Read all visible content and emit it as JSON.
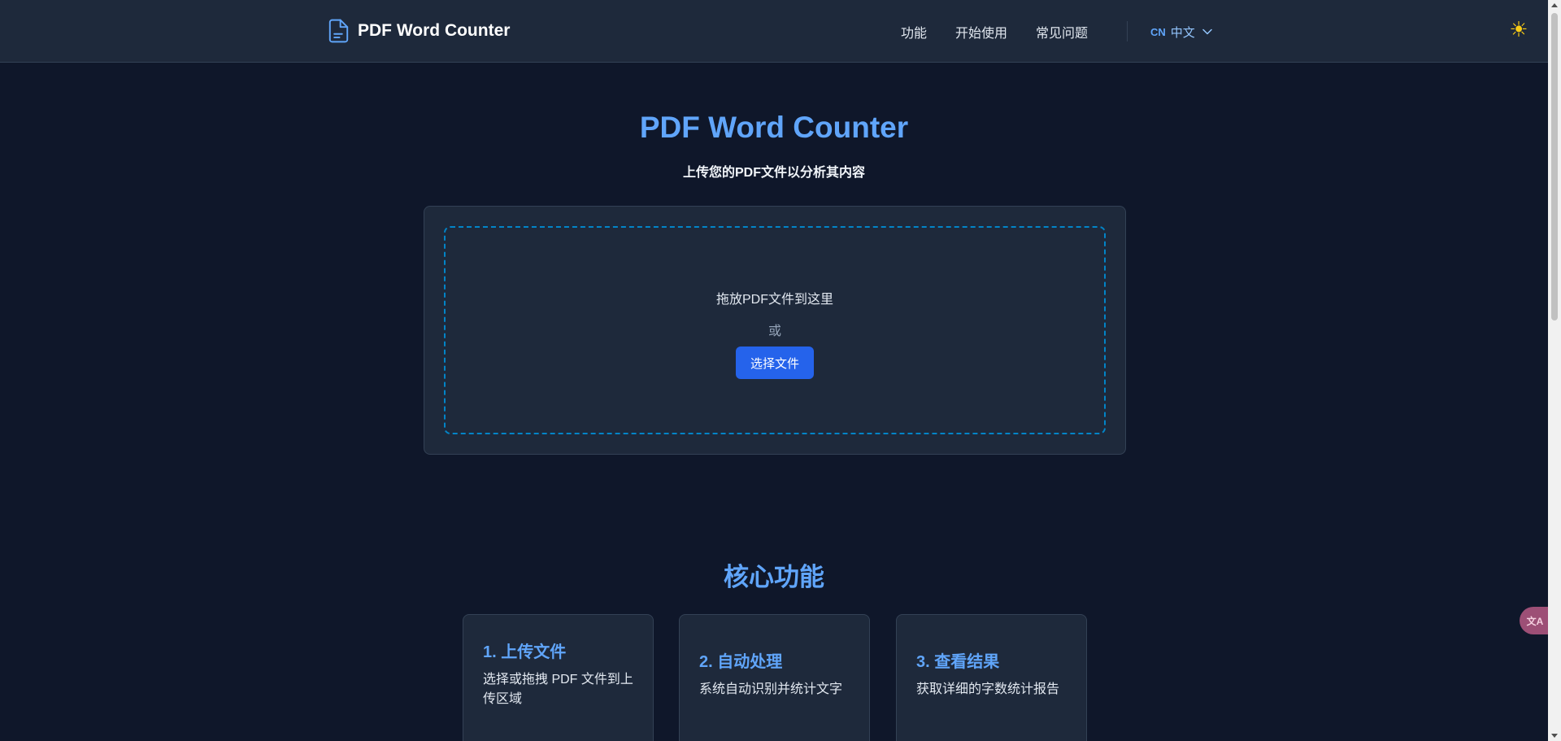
{
  "header": {
    "logo_text": "PDF Word Counter",
    "nav": [
      "功能",
      "开始使用",
      "常见问题"
    ],
    "lang_code": "CN",
    "lang_label": "中文",
    "theme_icon": "☀"
  },
  "hero": {
    "title": "PDF Word Counter",
    "subtitle": "上传您的PDF文件以分析其内容"
  },
  "upload": {
    "drop_text": "拖放PDF文件到这里",
    "or_text": "或",
    "button_label": "选择文件"
  },
  "features": {
    "title": "核心功能",
    "cards": [
      {
        "title": "1. 上传文件",
        "desc": "选择或拖拽 PDF 文件到上传区域"
      },
      {
        "title": "2. 自动处理",
        "desc": "系统自动识别并统计文字"
      },
      {
        "title": "3. 查看结果",
        "desc": "获取详细的字数统计报告"
      }
    ]
  },
  "widgets": {
    "translate_label": "文A"
  },
  "colors": {
    "background": "#0f172a",
    "surface": "#1e293b",
    "accent": "#60a5fa",
    "button": "#2563eb",
    "dropzone_border": "#0284c7"
  }
}
